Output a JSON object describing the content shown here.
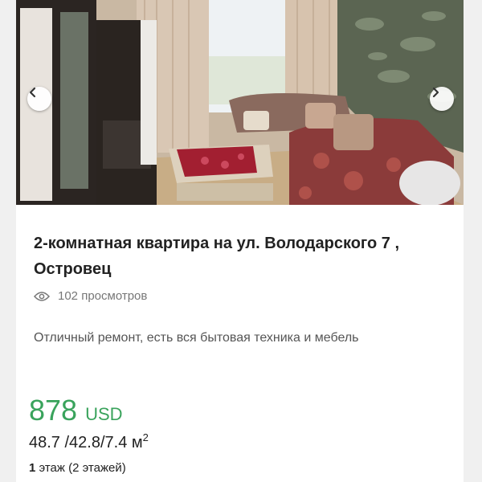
{
  "listing": {
    "title": "2-комнатная квартира на ул. Володарского 7 , Островец",
    "views": "102 просмотров",
    "description": "Отличный ремонт, есть вся бытовая техника и мебель",
    "price_amount": "878",
    "price_currency": "USD",
    "area": "48.7 /42.8/7.4 м",
    "area_unit_power": "2",
    "floor_number": "1",
    "floor_text": " этаж (2 этажей)"
  },
  "gallery": {
    "prev_icon": "chevron-left-icon",
    "next_icon": "chevron-right-icon"
  },
  "colors": {
    "price": "#3aa35c",
    "title": "#222222",
    "muted": "#777777"
  }
}
